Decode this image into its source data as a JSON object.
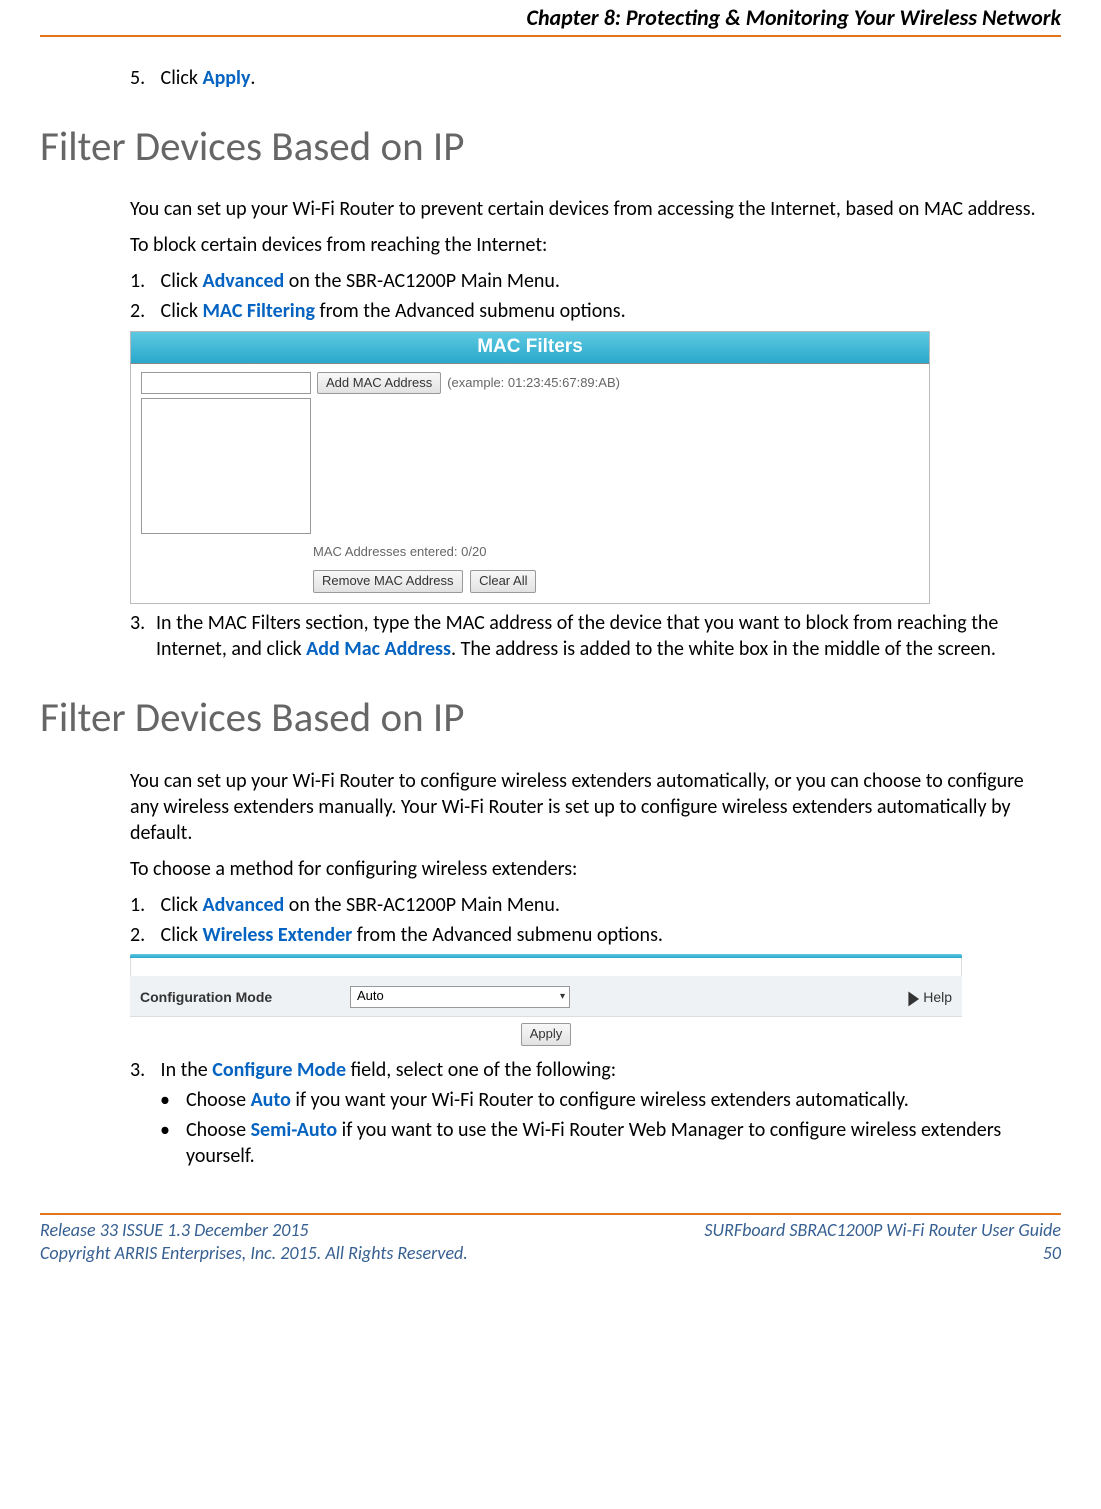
{
  "header": {
    "chapter": "Chapter 8: Protecting & Monitoring Your Wireless Network"
  },
  "step5": {
    "num": "5.",
    "prefix": "Click ",
    "link": "Apply",
    "suffix": "."
  },
  "section1": {
    "title": "Filter Devices Based on IP",
    "p1": "You can set up your Wi-Fi Router to prevent certain devices from accessing the Internet, based on MAC address.",
    "p2": "To block certain devices from reaching the Internet:",
    "s1": {
      "num": "1.",
      "a": "Click ",
      "link": "Advanced",
      "b": " on the SBR-AC1200P Main Menu."
    },
    "s2": {
      "num": "2.",
      "a": "Click ",
      "link": "MAC Filtering",
      "b": " from the Advanced submenu options."
    },
    "s3": {
      "num": "3.",
      "a": "In the MAC Filters section, type the MAC address of the device that you want to block from reaching the Internet, and click ",
      "link": "Add Mac Address",
      "b": ".  The address is added to the white box in the middle of the screen."
    }
  },
  "mac": {
    "title": "MAC Filters",
    "add_btn": "Add MAC Address",
    "example": "(example: 01:23:45:67:89:AB)",
    "count": "MAC Addresses entered: 0/20",
    "remove_btn": "Remove MAC Address",
    "clear_btn": "Clear All"
  },
  "section2": {
    "title": "Filter Devices Based on IP",
    "p1": "You can set up your Wi-Fi Router to configure wireless extenders automatically, or you can choose to configure any wireless extenders manually. Your Wi-Fi Router is set up to configure wireless extenders automatically by default.",
    "p2": "To choose a method for configuring wireless extenders:",
    "s1": {
      "num": "1.",
      "a": "Click ",
      "link": "Advanced",
      "b": " on the SBR-AC1200P Main Menu."
    },
    "s2": {
      "num": "2.",
      "a": "Click ",
      "link": "Wireless Extender",
      "b": " from the Advanced submenu options."
    },
    "s3": {
      "num": "3.",
      "a": "In the ",
      "link": "Configure Mode",
      "b": " field, select one of the following:"
    },
    "bullets": {
      "b1": {
        "a": "Choose ",
        "link": "Auto",
        "b": " if you want your Wi-Fi Router to configure wireless extenders automatically."
      },
      "b2": {
        "a": "Choose ",
        "link": "Semi-Auto",
        "b": " if you want to use the Wi-Fi Router Web Manager to configure wireless extenders yourself."
      }
    }
  },
  "ext": {
    "conf_label": "Configuration Mode",
    "selected": "Auto",
    "help": "Help",
    "apply": "Apply"
  },
  "footer": {
    "left1": "Release 33 ISSUE 1.3    December 2015",
    "right1": "SURFboard SBR﻿AC1200P Wi-Fi Router User Guide",
    "left2": "Copyright ARRIS Enterprises, Inc. 2015. All Rights Reserved.",
    "right2": "50"
  }
}
